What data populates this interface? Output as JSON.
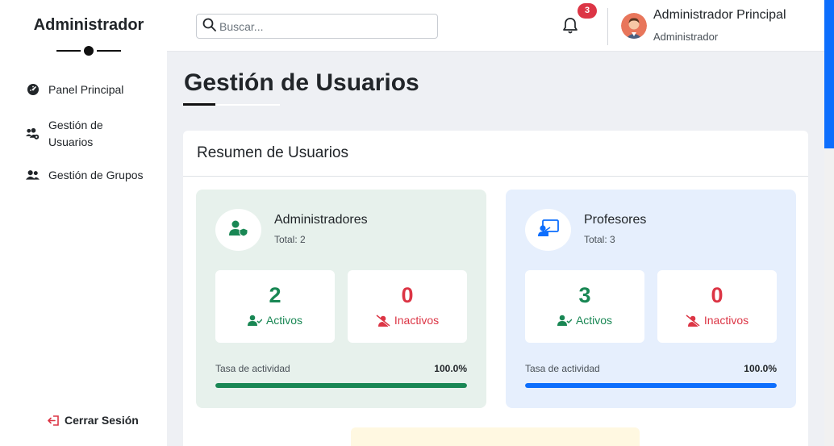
{
  "sidebar": {
    "brand": "Administrador",
    "items": [
      {
        "label": "Panel Principal",
        "icon": "dashboard-icon"
      },
      {
        "label": "Gestión de Usuarios",
        "icon": "users-cog-icon"
      },
      {
        "label": "Gestión de Grupos",
        "icon": "users-icon"
      }
    ],
    "logout": "Cerrar Sesión"
  },
  "header": {
    "search_placeholder": "Buscar...",
    "notification_count": "3",
    "user_name": "Administrador Principal",
    "user_role": "Administrador"
  },
  "main": {
    "page_title": "Gestión de Usuarios",
    "summary_title": "Resumen de Usuarios",
    "cards": [
      {
        "name": "Administradores",
        "total": "Total: 2",
        "active_count": "2",
        "active_label": "Activos",
        "inactive_count": "0",
        "inactive_label": "Inactivos",
        "rate_label": "Tasa de actividad",
        "rate_value": "100.0%",
        "rate_fraction": 1.0,
        "accent": "#198754"
      },
      {
        "name": "Profesores",
        "total": "Total: 3",
        "active_count": "3",
        "active_label": "Activos",
        "inactive_count": "0",
        "inactive_label": "Inactivos",
        "rate_label": "Tasa de actividad",
        "rate_value": "100.0%",
        "rate_fraction": 1.0,
        "accent": "#0d6efd"
      }
    ]
  },
  "colors": {
    "active": "#198754",
    "inactive": "#dc3545",
    "primary": "#0d6efd",
    "badge": "#dc3545"
  }
}
